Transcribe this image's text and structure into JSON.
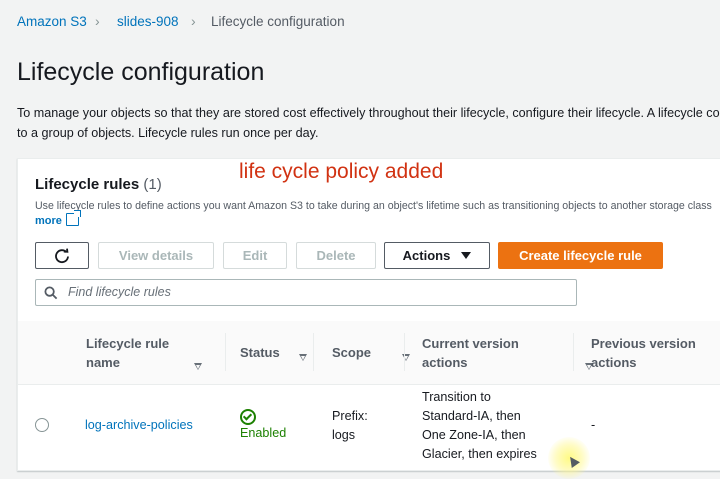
{
  "breadcrumb": {
    "items": [
      "Amazon S3",
      "slides-908",
      "Lifecycle configuration"
    ]
  },
  "page": {
    "title": "Lifecycle configuration",
    "description_line1": "To manage your objects so that they are stored cost effectively throughout their lifecycle, configure their lifecycle. A lifecycle configuration is a set of rules",
    "description_line2": "to a group of objects. Lifecycle rules run once per day."
  },
  "panel": {
    "title": "Lifecycle rules",
    "count": "(1)",
    "description": "Use lifecycle rules to define actions you want Amazon S3 to take during an object's lifetime such as transitioning objects to another storage class",
    "more_link": "more",
    "annotation": "life cycle policy added"
  },
  "toolbar": {
    "refresh_icon": "refresh-icon",
    "view_details_label": "View details",
    "edit_label": "Edit",
    "delete_label": "Delete",
    "actions_label": "Actions",
    "create_label": "Create lifecycle rule"
  },
  "search": {
    "placeholder": "Find lifecycle rules",
    "icon": "search-icon"
  },
  "table": {
    "headers": {
      "name_line1": "Lifecycle rule",
      "name_line2": "name",
      "status": "Status",
      "scope": "Scope",
      "current_line1": "Current version",
      "current_line2": "actions",
      "previous_line1": "Previous version",
      "previous_line2": "actions"
    },
    "rows": [
      {
        "name": "log-archive-policies",
        "status": "Enabled",
        "scope_line1": "Prefix:",
        "scope_line2": "logs",
        "current_line1": "Transition to",
        "current_line2": "Standard-IA, then",
        "current_line3": "One Zone-IA, then",
        "current_line4": "Glacier, then expires",
        "previous": "-"
      }
    ]
  },
  "colors": {
    "link": "#0073bb",
    "primary": "#ec7211",
    "success": "#1d8102",
    "annotation": "#d13212"
  }
}
